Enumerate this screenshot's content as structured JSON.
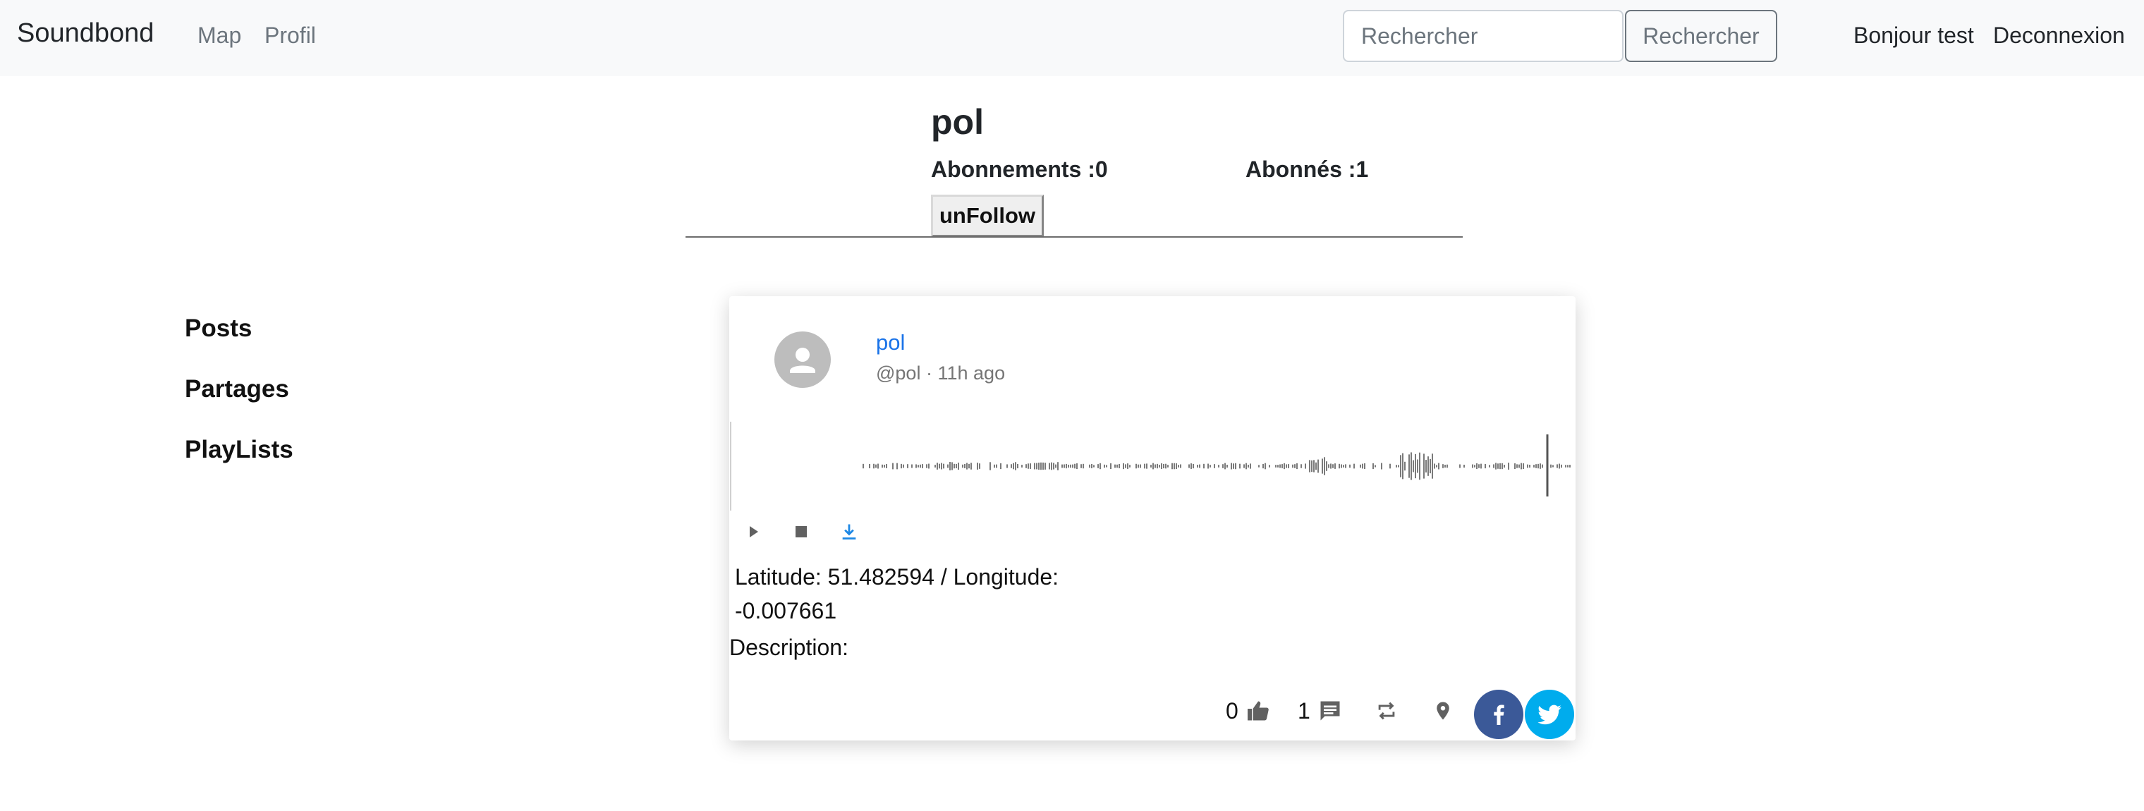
{
  "navbar": {
    "brand": "Soundbond",
    "links": [
      "Map",
      "Profil"
    ],
    "search_placeholder": "Rechercher",
    "search_button": "Rechercher",
    "greeting": "Bonjour test",
    "logout": "Deconnexion"
  },
  "profile": {
    "name": "pol",
    "subscriptions": "Abonnements :0",
    "followers": "Abonnés :1",
    "unfollow_label": "unFollow"
  },
  "menu": {
    "items": [
      "Posts",
      "Partages",
      "PlayLists"
    ]
  },
  "post": {
    "author": "pol",
    "handle": "@pol",
    "separator": "·",
    "time_ago": "11h ago",
    "coords_text": "Latitude: 51.482594 / Longitude: -0.007661",
    "description_label": "Description:",
    "likes": "0",
    "comments": "1",
    "icons": [
      "play-icon",
      "stop-icon",
      "download-icon",
      "thumb-up-icon",
      "comment-icon",
      "repost-icon",
      "location-pin-icon",
      "facebook-icon",
      "twitter-icon"
    ]
  },
  "colors": {
    "navbar_bg": "#f8f9fa",
    "link_blue": "#1a73e8",
    "facebook": "#3b5998",
    "twitter": "#00aced",
    "download_blue": "#1e88e5"
  }
}
